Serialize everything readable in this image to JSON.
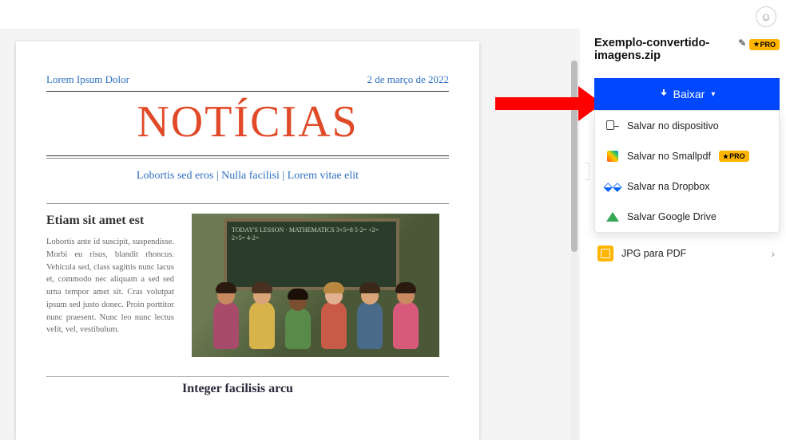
{
  "topbar": {
    "avatar_glyph": "☺"
  },
  "document": {
    "header_left": "Lorem Ipsum Dolor",
    "header_right": "2 de março de 2022",
    "title": "NOTÍCIAS",
    "subhead": "Lobortis sed eros | Nulla facilisi | Lorem vitae elit",
    "article_title": "Etiam sit amet est",
    "article_body": "Lobortis ante id suscipit, suspendisse. Morbi eu risus, blandit rhoncus. Vehicula sed, class sagittis nunc lacus et, commodo nec aliquam a sed sed urna tempor amet sit. Cras volutpat ipsum sed justo donec. Proin porttitor nunc praesent. Nunc leo nunc lectus velit, vel, vestibulum.",
    "blackboard_lines": "TODAY'S LESSON · MATHEMATICS\n3+5=8    5·2=\n+2=      2+5=\n4-2=",
    "footer_title": "Integer facilisis arcu"
  },
  "sidebar": {
    "filename": "Exemplo-convertido-imagens.zip",
    "pro_label": "PRO",
    "download_label": "Baixar",
    "menu": [
      {
        "label": "Salvar no dispositivo"
      },
      {
        "label": "Salvar no Smallpdf",
        "pro": true
      },
      {
        "label": "Salvar na Dropbox"
      },
      {
        "label": "Salvar Google Drive"
      }
    ],
    "extra_action": "JPG para PDF"
  }
}
